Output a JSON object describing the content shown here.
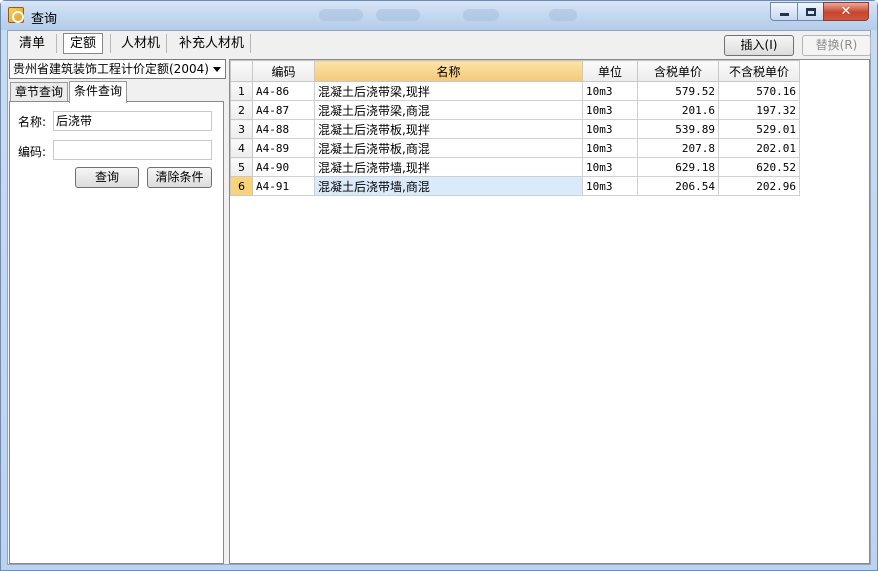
{
  "window": {
    "title": "查询"
  },
  "top_tabs": [
    {
      "label": "清单",
      "active": false
    },
    {
      "label": "定额",
      "active": true
    },
    {
      "label": "人材机",
      "active": false
    },
    {
      "label": "补充人材机",
      "active": false
    }
  ],
  "toolbar": {
    "insert_label": "插入(I)",
    "replace_label": "替换(R)"
  },
  "left_panel": {
    "quota_combo": "贵州省建筑装饰工程计价定额(2004)",
    "tabs": [
      {
        "label": "章节查询",
        "active": false
      },
      {
        "label": "条件查询",
        "active": true
      }
    ],
    "name_label": "名称:",
    "name_value": "后浇带",
    "code_label": "编码:",
    "code_value": "",
    "query_button": "查询",
    "clear_button": "清除条件"
  },
  "grid": {
    "columns": [
      "",
      "编码",
      "名称",
      "单位",
      "含税单价",
      "不含税单价"
    ],
    "rows": [
      {
        "num": "1",
        "code": "A4-86",
        "name": "混凝土后浇带梁,现拌",
        "unit": "10m3",
        "price_tax": "579.52",
        "price_notax": "570.16"
      },
      {
        "num": "2",
        "code": "A4-87",
        "name": "混凝土后浇带梁,商混",
        "unit": "10m3",
        "price_tax": "201.6",
        "price_notax": "197.32"
      },
      {
        "num": "3",
        "code": "A4-88",
        "name": "混凝土后浇带板,现拌",
        "unit": "10m3",
        "price_tax": "539.89",
        "price_notax": "529.01"
      },
      {
        "num": "4",
        "code": "A4-89",
        "name": "混凝土后浇带板,商混",
        "unit": "10m3",
        "price_tax": "207.8",
        "price_notax": "202.01"
      },
      {
        "num": "5",
        "code": "A4-90",
        "name": "混凝土后浇带墙,现拌",
        "unit": "10m3",
        "price_tax": "629.18",
        "price_notax": "620.52"
      },
      {
        "num": "6",
        "code": "A4-91",
        "name": "混凝土后浇带墙,商混",
        "unit": "10m3",
        "price_tax": "206.54",
        "price_notax": "202.96"
      }
    ],
    "selected_row": 6
  },
  "colors": {
    "title_bar": "#c3d7ef",
    "header_sorted": "#f5c977",
    "selected_row": "#dbeafb"
  }
}
